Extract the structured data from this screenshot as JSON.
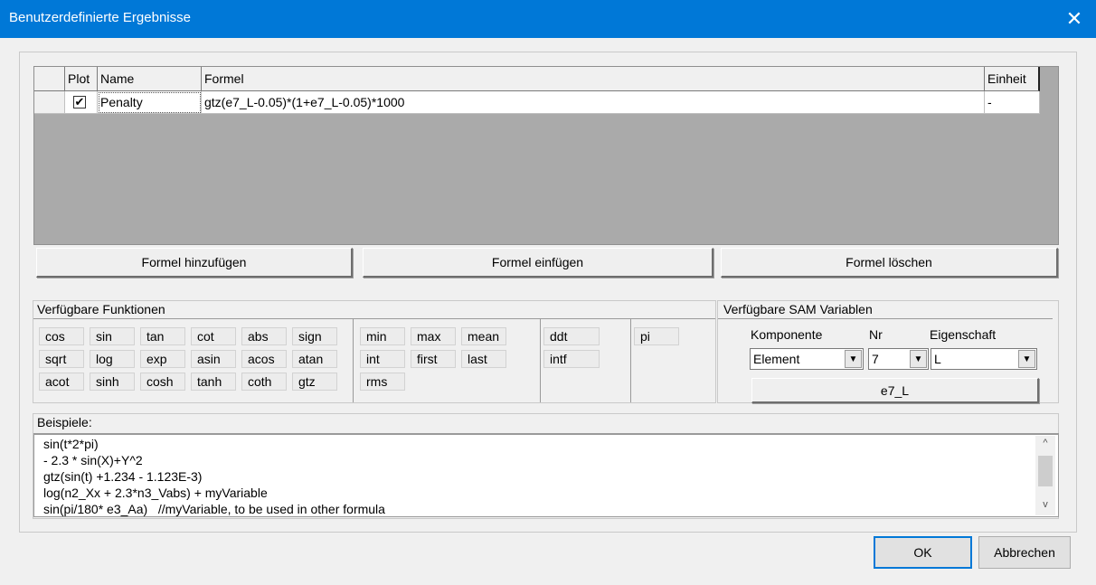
{
  "window": {
    "title": "Benutzerdefinierte Ergebnisse",
    "close_icon": "✕"
  },
  "grid": {
    "headers": {
      "plot": "Plot",
      "name": "Name",
      "formula": "Formel",
      "unit": "Einheit"
    },
    "rows": [
      {
        "plot_checked": "✔",
        "name": "Penalty",
        "formula": "gtz(e7_L-0.05)*(1+e7_L-0.05)*1000",
        "unit": "-"
      }
    ]
  },
  "formula_buttons": {
    "add": "Formel hinzufügen",
    "insert": "Formel einfügen",
    "delete": "Formel löschen"
  },
  "functions": {
    "label": "Verfügbare Funktionen",
    "math": [
      [
        "cos",
        "sin",
        "tan",
        "cot",
        "abs",
        "sign"
      ],
      [
        "sqrt",
        "log",
        "exp",
        "asin",
        "acos",
        "atan"
      ],
      [
        "acot",
        "sinh",
        "cosh",
        "tanh",
        "coth",
        "gtz"
      ]
    ],
    "stats": [
      [
        "min",
        "max",
        "mean"
      ],
      [
        "int",
        "first",
        "last"
      ],
      [
        "rms"
      ]
    ],
    "deriv": [
      "ddt",
      "intf"
    ],
    "const": [
      "pi"
    ]
  },
  "sam": {
    "label": "Verfügbare SAM Variablen",
    "komponente_label": "Komponente",
    "nr_label": "Nr",
    "eigenschaft_label": "Eigenschaft",
    "komponente_value": "Element",
    "nr_value": "7",
    "eigenschaft_value": "L",
    "result_button": "e7_L"
  },
  "examples": {
    "label": "Beispiele:",
    "lines": [
      "sin(t*2*pi)",
      "- 2.3 * sin(X)+Y^2",
      "gtz(sin(t) +1.234 - 1.123E-3)",
      "log(n2_Xx + 2.3*n3_Vabs) + myVariable",
      "sin(pi/180* e3_Aa)   //myVariable, to be used in other formula"
    ]
  },
  "footer": {
    "ok": "OK",
    "cancel": "Abbrechen"
  }
}
